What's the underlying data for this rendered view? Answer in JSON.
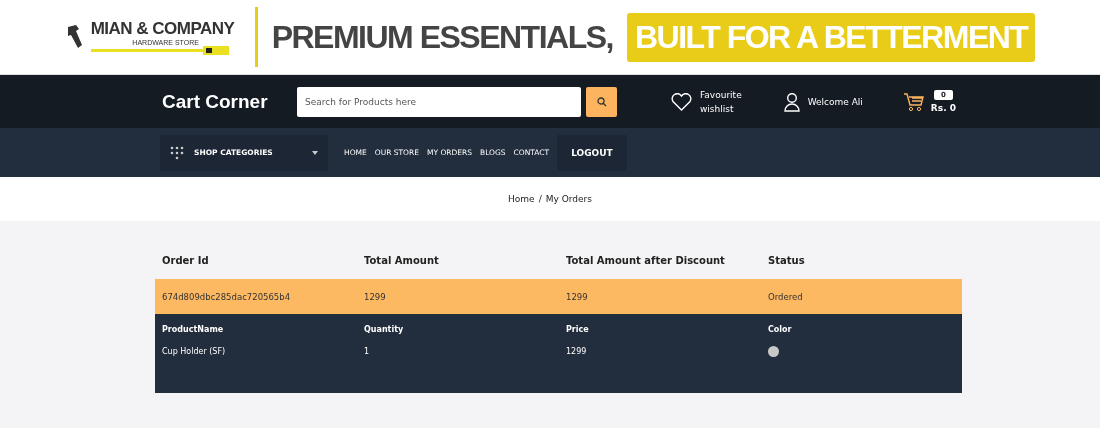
{
  "banner": {
    "brand": "MIAN & COMPANY",
    "brand_sub": "HARDWARE STORE",
    "headline": "PREMIUM ESSENTIALS,",
    "highlight": "BUILT FOR A BETTERMENT"
  },
  "header": {
    "logo": "Cart Corner",
    "search": {
      "placeholder": "Search for Products here"
    },
    "wishlist": {
      "line_1": "Favourite",
      "line_2": "wishlist"
    },
    "account": "Welcome Ali",
    "cart": {
      "count": "0",
      "total": "Rs. 0"
    }
  },
  "nav": {
    "categories": "SHOP CATEGORIES",
    "links": [
      "HOME",
      "OUR STORE",
      "MY ORDERS",
      "BLOGS",
      "CONTACT"
    ],
    "logout": "LOGOUT"
  },
  "breadcrumb": {
    "items": [
      "Home",
      "My Orders"
    ],
    "separator": "/"
  },
  "orders": {
    "columns": [
      "Order Id",
      "Total Amount",
      "Total Amount after Discount",
      "Status"
    ],
    "rows": [
      {
        "order_id": "674d809dbc285dac720565b4",
        "total": "1299",
        "total_after_discount": "1299",
        "status": "Ordered",
        "items": {
          "columns": [
            "ProductName",
            "Quantity",
            "Price",
            "Color"
          ],
          "rows": [
            {
              "name": "Cup Holder (SF)",
              "quantity": "1",
              "price": "1299",
              "color": "#c8c8c8"
            }
          ]
        }
      }
    ]
  }
}
